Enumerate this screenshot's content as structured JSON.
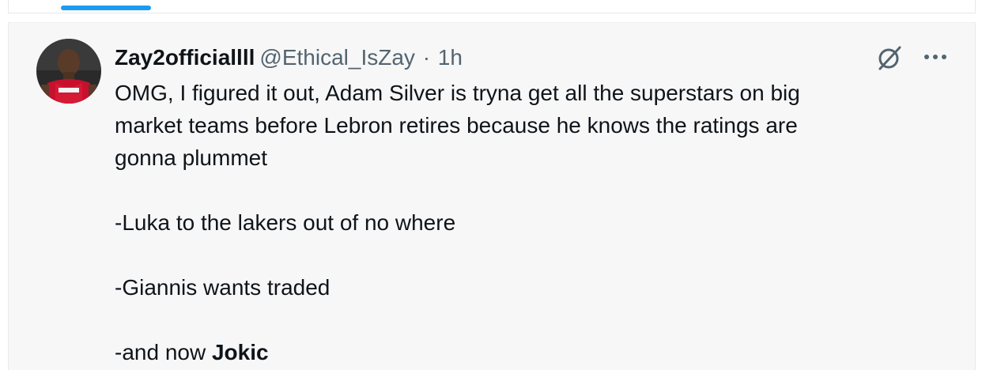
{
  "tweet": {
    "display_name": "Zay2officiallll",
    "handle": "@Ethical_IsZay",
    "separator": "·",
    "time": "1h",
    "lines": [
      "OMG, I figured it out, Adam Silver is tryna get all the superstars on big",
      "market teams before Lebron retires because he knows the ratings are",
      "gonna plummet",
      "-Luka to the lakers out of no where",
      "-Giannis wants traded"
    ],
    "last_line_prefix": "-and now ",
    "last_line_bold": "Jokic"
  },
  "icons": {
    "grok": "grok-icon",
    "more": "more-icon"
  },
  "colors": {
    "accent": "#1d9bf0",
    "text": "#0f1419",
    "secondary": "#536471",
    "background": "#f7f7f7"
  }
}
